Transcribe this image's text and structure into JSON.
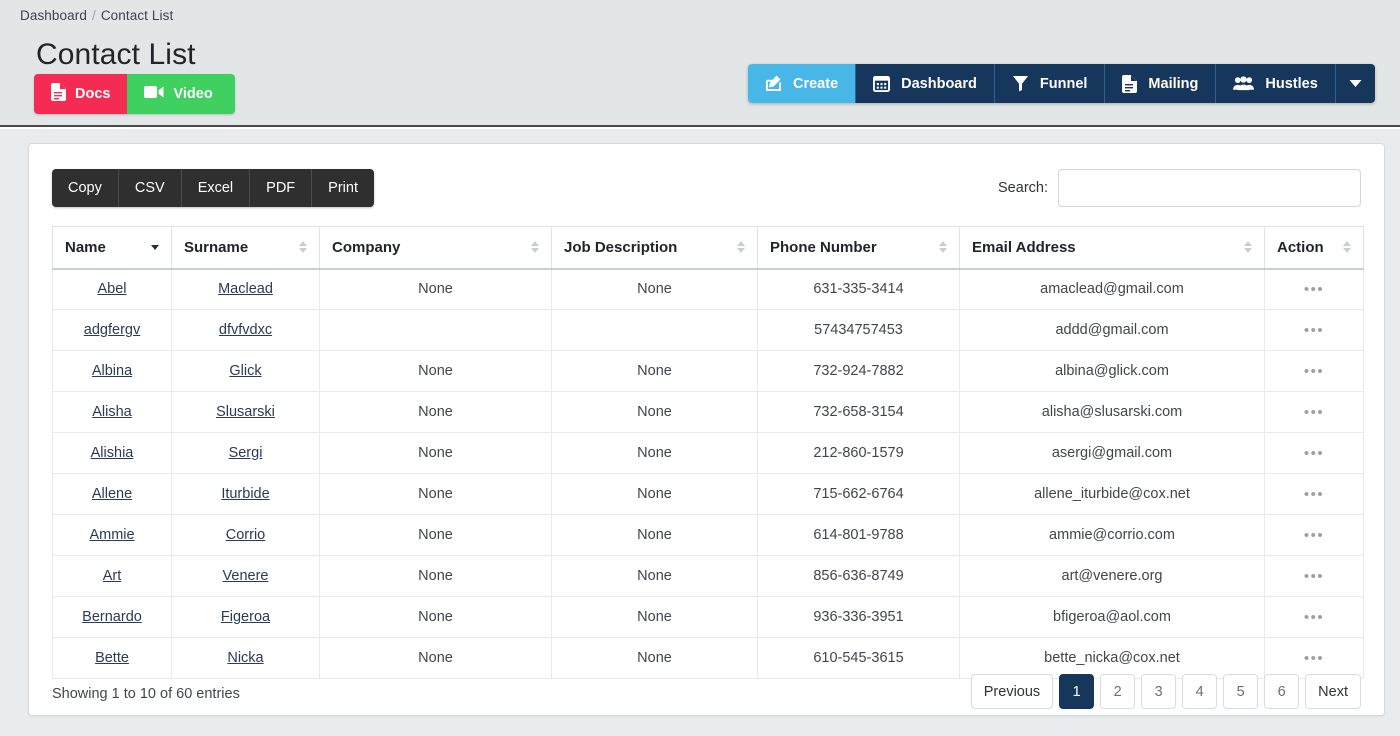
{
  "breadcrumb": {
    "root": "Dashboard",
    "separator": "/",
    "current": "Contact List"
  },
  "page": {
    "title": "Contact List"
  },
  "help_buttons": [
    {
      "label": "Docs",
      "icon": "document-icon",
      "color": "#f42b52"
    },
    {
      "label": "Video",
      "icon": "video-camera-icon",
      "color": "#3fd05f"
    }
  ],
  "nav": {
    "active_color": "#49b6e8",
    "base_color": "#17365c",
    "items": [
      {
        "label": "Create",
        "icon": "pencil-square-icon",
        "active": true
      },
      {
        "label": "Dashboard",
        "icon": "calendar-icon",
        "active": false
      },
      {
        "label": "Funnel",
        "icon": "funnel-icon",
        "active": false
      },
      {
        "label": "Mailing",
        "icon": "document-icon",
        "active": false
      },
      {
        "label": "Hustles",
        "icon": "users-icon",
        "active": false
      }
    ],
    "caret": {
      "icon": "chevron-down-icon"
    }
  },
  "toolbar": {
    "export_buttons": [
      "Copy",
      "CSV",
      "Excel",
      "PDF",
      "Print"
    ],
    "search_label": "Search:",
    "search_value": "",
    "search_placeholder": ""
  },
  "table": {
    "columns": [
      {
        "label": "Name",
        "sort": "desc"
      },
      {
        "label": "Surname",
        "sort": "none"
      },
      {
        "label": "Company",
        "sort": "none"
      },
      {
        "label": "Job Description",
        "sort": "none"
      },
      {
        "label": "Phone Number",
        "sort": "none"
      },
      {
        "label": "Email Address",
        "sort": "none"
      },
      {
        "label": "Action",
        "sort": "none"
      }
    ],
    "rows": [
      {
        "name": "Abel",
        "surname": "Maclead",
        "company": "None",
        "job": "None",
        "phone": "631-335-3414",
        "email": "amaclead@gmail.com",
        "action": "•••"
      },
      {
        "name": "adgfergv",
        "surname": "dfvfvdxc",
        "company": "",
        "job": "",
        "phone": "57434757453",
        "email": "addd@gmail.com",
        "action": "•••"
      },
      {
        "name": "Albina",
        "surname": "Glick",
        "company": "None",
        "job": "None",
        "phone": "732-924-7882",
        "email": "albina@glick.com",
        "action": "•••"
      },
      {
        "name": "Alisha",
        "surname": "Slusarski",
        "company": "None",
        "job": "None",
        "phone": "732-658-3154",
        "email": "alisha@slusarski.com",
        "action": "•••"
      },
      {
        "name": "Alishia",
        "surname": "Sergi",
        "company": "None",
        "job": "None",
        "phone": "212-860-1579",
        "email": "asergi@gmail.com",
        "action": "•••"
      },
      {
        "name": "Allene",
        "surname": "Iturbide",
        "company": "None",
        "job": "None",
        "phone": "715-662-6764",
        "email": "allene_iturbide@cox.net",
        "action": "•••"
      },
      {
        "name": "Ammie",
        "surname": "Corrio",
        "company": "None",
        "job": "None",
        "phone": "614-801-9788",
        "email": "ammie@corrio.com",
        "action": "•••"
      },
      {
        "name": "Art",
        "surname": "Venere",
        "company": "None",
        "job": "None",
        "phone": "856-636-8749",
        "email": "art@venere.org",
        "action": "•••"
      },
      {
        "name": "Bernardo",
        "surname": "Figeroa",
        "company": "None",
        "job": "None",
        "phone": "936-336-3951",
        "email": "bfigeroa@aol.com",
        "action": "•••"
      },
      {
        "name": "Bette",
        "surname": "Nicka",
        "company": "None",
        "job": "None",
        "phone": "610-545-3615",
        "email": "bette_nicka@cox.net",
        "action": "•••"
      }
    ]
  },
  "footer": {
    "info": "Showing 1 to 10 of 60 entries",
    "pagination": {
      "previous": "Previous",
      "next": "Next",
      "pages": [
        "1",
        "2",
        "3",
        "4",
        "5",
        "6"
      ],
      "active_page": "1"
    }
  }
}
